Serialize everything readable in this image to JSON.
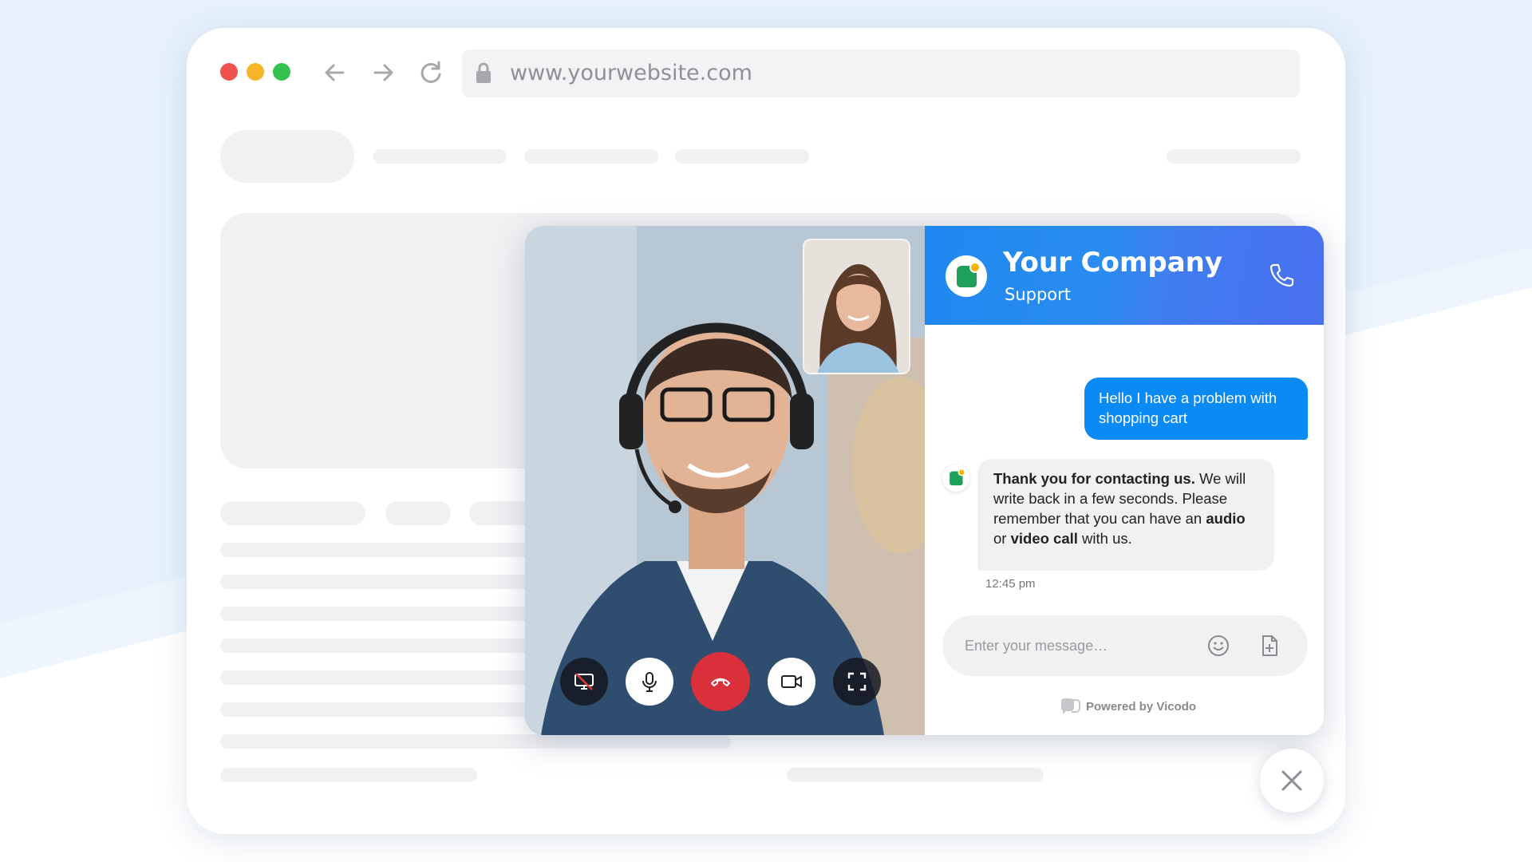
{
  "browser": {
    "url": "www.yourwebsite.com"
  },
  "chat": {
    "company_name": "Your Company",
    "subtitle": "Support",
    "outgoing_message": "Hello I have a problem with shopping cart",
    "incoming_message": {
      "part1_bold": "Thank you for contacting us.",
      "part2": " We will write back in a few seconds. Please remember that you can have an ",
      "part3_bold": "audio",
      "part4": " or ",
      "part5_bold": "video call",
      "part6": " with us."
    },
    "timestamp": "12:45 pm",
    "input_placeholder": "Enter your message…",
    "powered_by": "Powered by Vicodo"
  },
  "video_controls": [
    "screen-share-off-icon",
    "microphone-icon",
    "hang-up-icon",
    "camera-icon",
    "fullscreen-icon"
  ],
  "colors": {
    "header_blue": "#1e88f0",
    "message_blue": "#0a8af5",
    "hangup_red": "#d9303c",
    "logo_green": "#1fa05a",
    "logo_dot": "#f5b400"
  }
}
